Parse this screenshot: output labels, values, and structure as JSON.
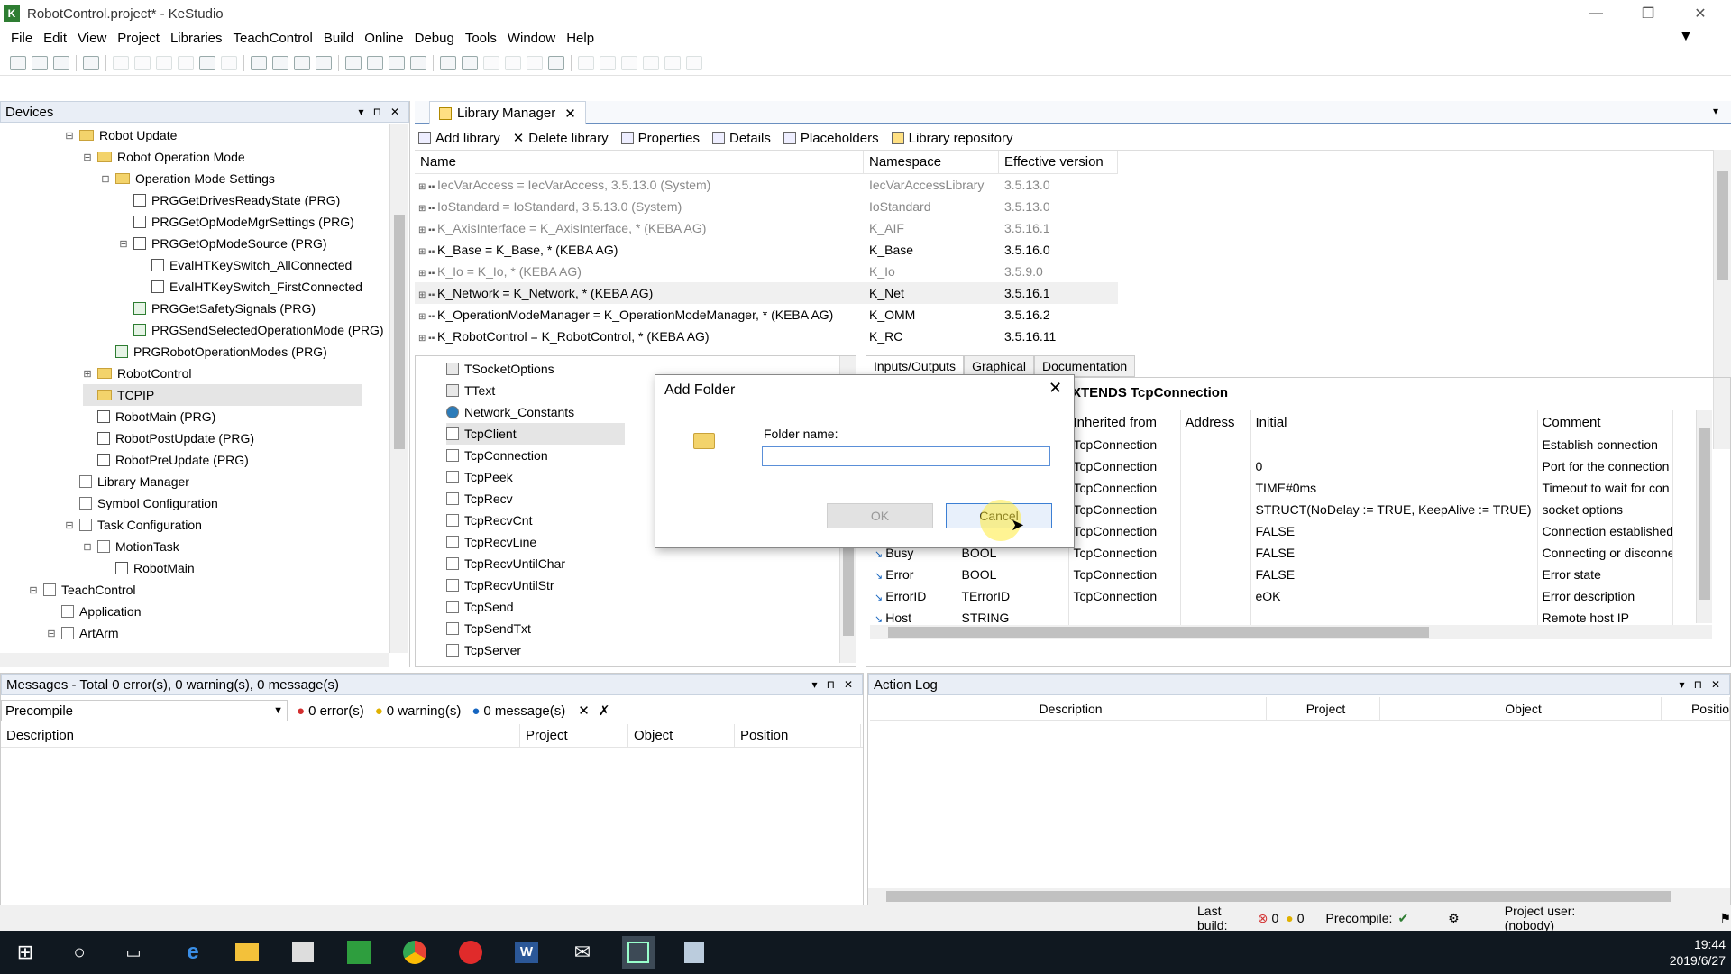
{
  "window": {
    "title": "RobotControl.project* - KeStudio",
    "app_icon": "kestudio-icon",
    "minimize": "—",
    "restore": "❐",
    "close": "✕"
  },
  "menu": [
    "File",
    "Edit",
    "View",
    "Project",
    "Libraries",
    "TeachControl",
    "Build",
    "Online",
    "Debug",
    "Tools",
    "Window",
    "Help"
  ],
  "devices": {
    "title": "Devices",
    "tree": [
      {
        "label": "Robot Update",
        "icon": "folder",
        "indent": 0,
        "exp": "⊟"
      },
      {
        "label": "Robot Operation Mode",
        "icon": "folder",
        "indent": 1,
        "exp": "⊟"
      },
      {
        "label": "Operation Mode Settings",
        "icon": "folder",
        "indent": 2,
        "exp": "⊟"
      },
      {
        "label": "PRGGetDrivesReadyState (PRG)",
        "icon": "prg",
        "indent": 3,
        "exp": ""
      },
      {
        "label": "PRGGetOpModeMgrSettings (PRG)",
        "icon": "prg",
        "indent": 3,
        "exp": ""
      },
      {
        "label": "PRGGetOpModeSource (PRG)",
        "icon": "prg",
        "indent": 3,
        "exp": "⊟"
      },
      {
        "label": "EvalHTKeySwitch_AllConnected",
        "icon": "prg",
        "indent": 4,
        "exp": ""
      },
      {
        "label": "EvalHTKeySwitch_FirstConnected",
        "icon": "prg",
        "indent": 4,
        "exp": ""
      },
      {
        "label": "PRGGetSafetySignals (PRG)",
        "icon": "prgg",
        "indent": 3,
        "exp": ""
      },
      {
        "label": "PRGSendSelectedOperationMode (PRG)",
        "icon": "prgg",
        "indent": 3,
        "exp": ""
      },
      {
        "label": "PRGRobotOperationModes (PRG)",
        "icon": "prgg",
        "indent": 2,
        "exp": ""
      },
      {
        "label": "RobotControl",
        "icon": "folder",
        "indent": 1,
        "exp": "⊞"
      },
      {
        "label": "TCPIP",
        "icon": "folder",
        "indent": 1,
        "exp": ""
      },
      {
        "label": "RobotMain (PRG)",
        "icon": "prg",
        "indent": 1,
        "exp": ""
      },
      {
        "label": "RobotPostUpdate (PRG)",
        "icon": "prg",
        "indent": 1,
        "exp": ""
      },
      {
        "label": "RobotPreUpdate (PRG)",
        "icon": "prg",
        "indent": 1,
        "exp": ""
      },
      {
        "label": "Library Manager",
        "icon": "lib",
        "indent": 0,
        "exp": ""
      },
      {
        "label": "Symbol Configuration",
        "icon": "sym",
        "indent": 0,
        "exp": ""
      },
      {
        "label": "Task Configuration",
        "icon": "task",
        "indent": 0,
        "exp": "⊟"
      },
      {
        "label": "MotionTask",
        "icon": "task",
        "indent": 1,
        "exp": "⊟"
      },
      {
        "label": "RobotMain",
        "icon": "prg",
        "indent": 2,
        "exp": ""
      },
      {
        "label": "TeachControl",
        "icon": "grid",
        "indent": -2,
        "exp": "⊟"
      },
      {
        "label": "Application",
        "icon": "app",
        "indent": -1,
        "exp": ""
      },
      {
        "label": "ArtArm",
        "icon": "arm",
        "indent": -1,
        "exp": "⊟"
      }
    ]
  },
  "library_manager": {
    "tab_label": "Library Manager",
    "toolbar": [
      "Add library",
      "Delete library",
      "Properties",
      "Details",
      "Placeholders",
      "Library repository"
    ],
    "columns": [
      "Name",
      "Namespace",
      "Effective version"
    ],
    "rows": [
      {
        "name": "IecVarAccess = IecVarAccess, 3.5.13.0 (System)",
        "ns": "IecVarAccessLibrary",
        "ver": "3.5.13.0",
        "grey": true
      },
      {
        "name": "IoStandard = IoStandard, 3.5.13.0 (System)",
        "ns": "IoStandard",
        "ver": "3.5.13.0",
        "grey": true
      },
      {
        "name": "K_AxisInterface = K_AxisInterface, * (KEBA AG)",
        "ns": "K_AIF",
        "ver": "3.5.16.1",
        "grey": true
      },
      {
        "name": "K_Base = K_Base, * (KEBA AG)",
        "ns": "K_Base",
        "ver": "3.5.16.0",
        "grey": false
      },
      {
        "name": "K_Io = K_Io, * (KEBA AG)",
        "ns": "K_Io",
        "ver": "3.5.9.0",
        "grey": true
      },
      {
        "name": "K_Network = K_Network, * (KEBA AG)",
        "ns": "K_Net",
        "ver": "3.5.16.1",
        "grey": false
      },
      {
        "name": "K_OperationModeManager = K_OperationModeManager, * (KEBA AG)",
        "ns": "K_OMM",
        "ver": "3.5.16.2",
        "grey": false
      },
      {
        "name": "K_RobotControl = K_RobotControl, * (KEBA AG)",
        "ns": "K_RC",
        "ver": "3.5.16.11",
        "grey": false
      }
    ],
    "lower_list": [
      "TSocketOptions",
      "TText",
      "Network_Constants",
      "TcpClient",
      "TcpConnection",
      "TcpPeek",
      "TcpRecv",
      "TcpRecvCnt",
      "TcpRecvLine",
      "TcpRecvUntilChar",
      "TcpRecvUntilStr",
      "TcpSend",
      "TcpSendTxt",
      "TcpServer"
    ],
    "detail_tabs": [
      "Inputs/Outputs",
      "Graphical",
      "Documentation"
    ],
    "detail_title": "XTENDS TcpConnection",
    "io_columns": [
      "Inherited from",
      "Address",
      "Initial",
      "Comment"
    ],
    "io_rows": [
      {
        "name": "",
        "type": "",
        "inh": "TcpConnection",
        "addr": "",
        "init": "",
        "comment": "Establish connection"
      },
      {
        "name": "",
        "type": "",
        "inh": "TcpConnection",
        "addr": "",
        "init": "0",
        "comment": "Port for the connection"
      },
      {
        "name": "",
        "type": "",
        "inh": "TcpConnection",
        "addr": "",
        "init": "TIME#0ms",
        "comment": "Timeout to wait for con"
      },
      {
        "name": "",
        "type": "",
        "inh": "TcpConnection",
        "addr": "",
        "init": "STRUCT(NoDelay := TRUE, KeepAlive := TRUE)",
        "comment": "socket options"
      },
      {
        "name": "",
        "type": "",
        "inh": "TcpConnection",
        "addr": "",
        "init": "FALSE",
        "comment": "Connection established"
      },
      {
        "name": "Busy",
        "type": "BOOL",
        "inh": "TcpConnection",
        "addr": "",
        "init": "FALSE",
        "comment": "Connecting or disconne"
      },
      {
        "name": "Error",
        "type": "BOOL",
        "inh": "TcpConnection",
        "addr": "",
        "init": "FALSE",
        "comment": "Error state"
      },
      {
        "name": "ErrorID",
        "type": "TErrorID",
        "inh": "TcpConnection",
        "addr": "",
        "init": "eOK",
        "comment": "Error description"
      },
      {
        "name": "Host",
        "type": "STRING",
        "inh": "",
        "addr": "",
        "init": "",
        "comment": "Remote host IP"
      }
    ]
  },
  "dialog": {
    "title": "Add Folder",
    "field_label": "Folder name:",
    "field_value": "",
    "ok": "OK",
    "cancel": "Cancel"
  },
  "messages": {
    "title": "Messages - Total 0 error(s), 0 warning(s), 0 message(s)",
    "filter": "Precompile",
    "errors": "0 error(s)",
    "warnings": "0 warning(s)",
    "msgs": "0 message(s)",
    "columns": [
      "Description",
      "Project",
      "Object",
      "Position"
    ]
  },
  "action_log": {
    "title": "Action Log",
    "columns": [
      "Description",
      "Project",
      "Object",
      "Positio"
    ]
  },
  "status": {
    "last_build": "Last build:",
    "err_count": "0",
    "warn_count": "0",
    "precompile": "Precompile:",
    "user": "Project user: (nobody)"
  },
  "taskbar": {
    "time": "19:44",
    "date": "2019/6/27"
  }
}
